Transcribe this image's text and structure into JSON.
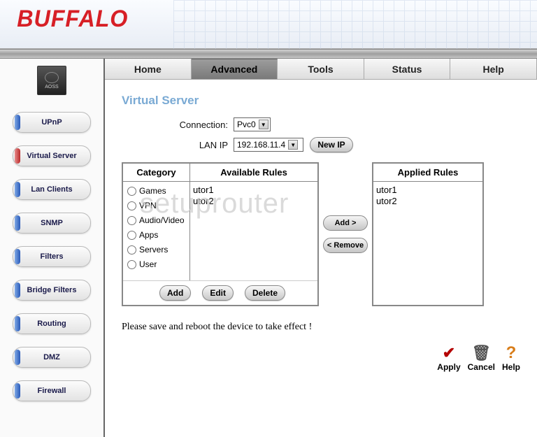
{
  "brand": "BUFFALO",
  "aoss_label": "AOSS",
  "sidebar": {
    "items": [
      {
        "label": "UPnP",
        "color": "blue"
      },
      {
        "label": "Virtual Server",
        "color": "red"
      },
      {
        "label": "Lan Clients",
        "color": "blue"
      },
      {
        "label": "SNMP",
        "color": "blue"
      },
      {
        "label": "Filters",
        "color": "blue"
      },
      {
        "label": "Bridge Filters",
        "color": "blue"
      },
      {
        "label": "Routing",
        "color": "blue"
      },
      {
        "label": "DMZ",
        "color": "blue"
      },
      {
        "label": "Firewall",
        "color": "blue"
      }
    ]
  },
  "tabs": [
    "Home",
    "Advanced",
    "Tools",
    "Status",
    "Help"
  ],
  "active_tab": 1,
  "page_title": "Virtual Server",
  "form": {
    "connection_label": "Connection:",
    "connection_value": "Pvc0",
    "lanip_label": "LAN IP",
    "lanip_value": "192.168.11.4",
    "newip_label": "New IP"
  },
  "category_header": "Category",
  "available_header": "Available Rules",
  "applied_header": "Applied Rules",
  "categories": [
    "Games",
    "VPN",
    "Audio/Video",
    "Apps",
    "Servers",
    "User"
  ],
  "available_rules": [
    "utor1",
    "utor2"
  ],
  "applied_rules": [
    "utor1",
    "utor2"
  ],
  "buttons": {
    "add": "Add",
    "edit": "Edit",
    "delete": "Delete",
    "add_to": "Add >",
    "remove": "< Remove"
  },
  "note": "Please save and reboot the device to take effect !",
  "actions": {
    "apply": "Apply",
    "cancel": "Cancel",
    "help": "Help"
  },
  "watermark": "setuprouter"
}
